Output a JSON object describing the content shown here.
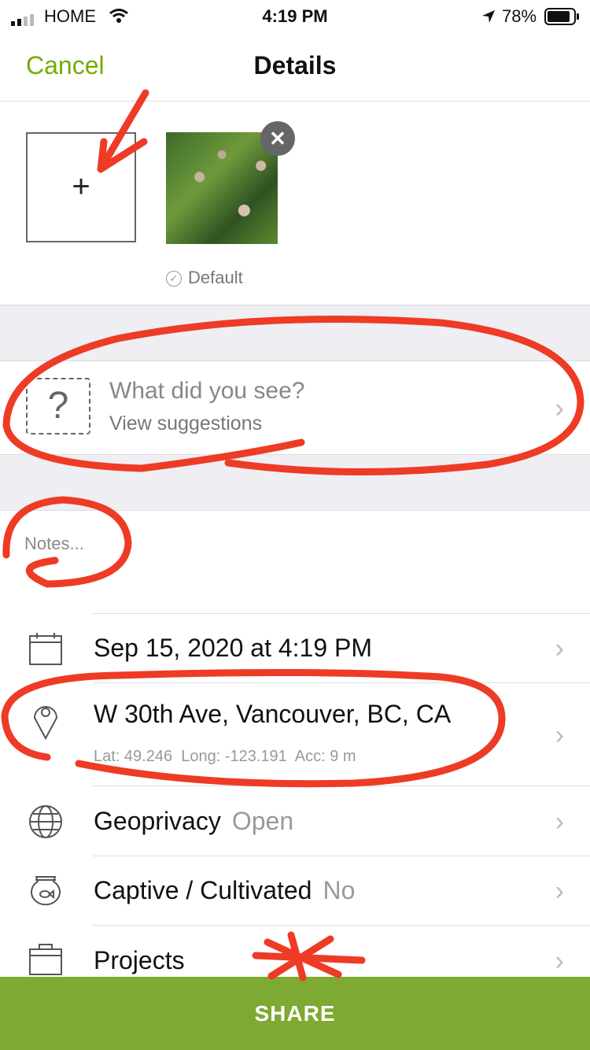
{
  "status": {
    "carrier": "HOME",
    "time": "4:19 PM",
    "battery": "78%"
  },
  "nav": {
    "cancel": "Cancel",
    "title": "Details"
  },
  "photos": {
    "add_symbol": "+",
    "default_label": "Default",
    "remove_symbol": "✕"
  },
  "species": {
    "prompt": "What did you see?",
    "sub": "View suggestions"
  },
  "notes": {
    "placeholder": "Notes..."
  },
  "rows": {
    "date": "Sep 15, 2020 at 4:19 PM",
    "location": "W 30th Ave, Vancouver, BC, CA",
    "location_sub": "Lat: 49.246  Long: -123.191  Acc: 9 m",
    "geoprivacy_label": "Geoprivacy",
    "geoprivacy_value": "Open",
    "captive_label": "Captive / Cultivated",
    "captive_value": "No",
    "projects_label": "Projects"
  },
  "share": "SHARE",
  "colors": {
    "accent": "#74ac00",
    "share_bg": "#7ea932",
    "annotation": "#ee3b25"
  }
}
